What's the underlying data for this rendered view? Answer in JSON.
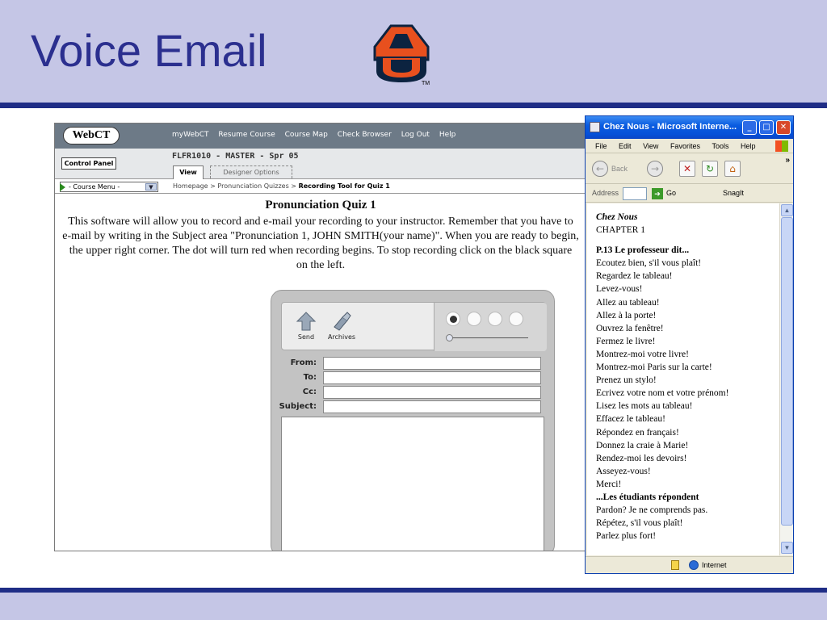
{
  "slide": {
    "title": "Voice Email",
    "logo_mark": "TM"
  },
  "webct": {
    "logo": "WebCT",
    "nav": [
      "myWebCT",
      "Resume Course",
      "Course Map",
      "Check Browser",
      "Log Out",
      "Help"
    ],
    "control_panel": "Control Panel",
    "course_title": "FLFR1010 - MASTER - Spr 05",
    "tab_view": "View",
    "tab_designer": "Designer Options",
    "course_menu": "- Course Menu -",
    "breadcrumb": {
      "path": "Homepage > Pronunciation Quizzes > ",
      "current": "Recording Tool for Quiz 1"
    },
    "quiz_title": "Pronunciation Quiz 1",
    "quiz_lines": [
      "This software will allow you to record and e-mail your recording to your instructor. Remember that you have to",
      "e-mail by writing in the Subject area \"Pronunciation 1, JOHN SMITH(your name)\". When you are ready to begin,",
      "the upper right corner. The dot will turn red when recording begins. To stop recording click on the black square",
      "on the left."
    ],
    "recorder": {
      "send": "Send",
      "archives": "Archives",
      "from": "From:",
      "to": "To:",
      "cc": "Cc:",
      "subject": "Subject:"
    }
  },
  "ie": {
    "title": "Chez Nous - Microsoft Interne...",
    "menu": [
      "File",
      "Edit",
      "View",
      "Favorites",
      "Tools",
      "Help"
    ],
    "back": "Back",
    "address": "Address",
    "go": "Go",
    "snagit": "SnagIt",
    "status_zone": "Internet",
    "content": {
      "book": "Chez Nous",
      "chapter": "CHAPTER 1",
      "section": "P.13   Le professeur dit...",
      "lines": [
        "Ecoutez bien, s'il vous plaît!",
        "Regardez le tableau!",
        "Levez-vous!",
        "Allez au tableau!",
        "Allez à la porte!",
        "Ouvrez la fenêtre!",
        "Fermez le livre!",
        "Montrez-moi votre livre!",
        "Montrez-moi Paris sur la carte!",
        "Prenez un stylo!",
        "Ecrivez votre nom et votre prénom!",
        "Lisez les mots au tableau!",
        "Effacez le tableau!",
        "Répondez en français!",
        "Donnez la craie à Marie!",
        "Rendez-moi les devoirs!",
        "Asseyez-vous!",
        "Merci!"
      ],
      "section2": "...Les étudiants répondent",
      "lines2": [
        "Pardon? Je ne comprends pas.",
        "Répétez, s'il vous plaît!",
        "Parlez plus fort!"
      ]
    }
  },
  "colors": {
    "slide_bg": "#c5c6e6",
    "title_blue": "#2b2f8f",
    "rule": "#1f2d86",
    "logo_orange": "#e8501e",
    "logo_navy": "#0c2340"
  }
}
